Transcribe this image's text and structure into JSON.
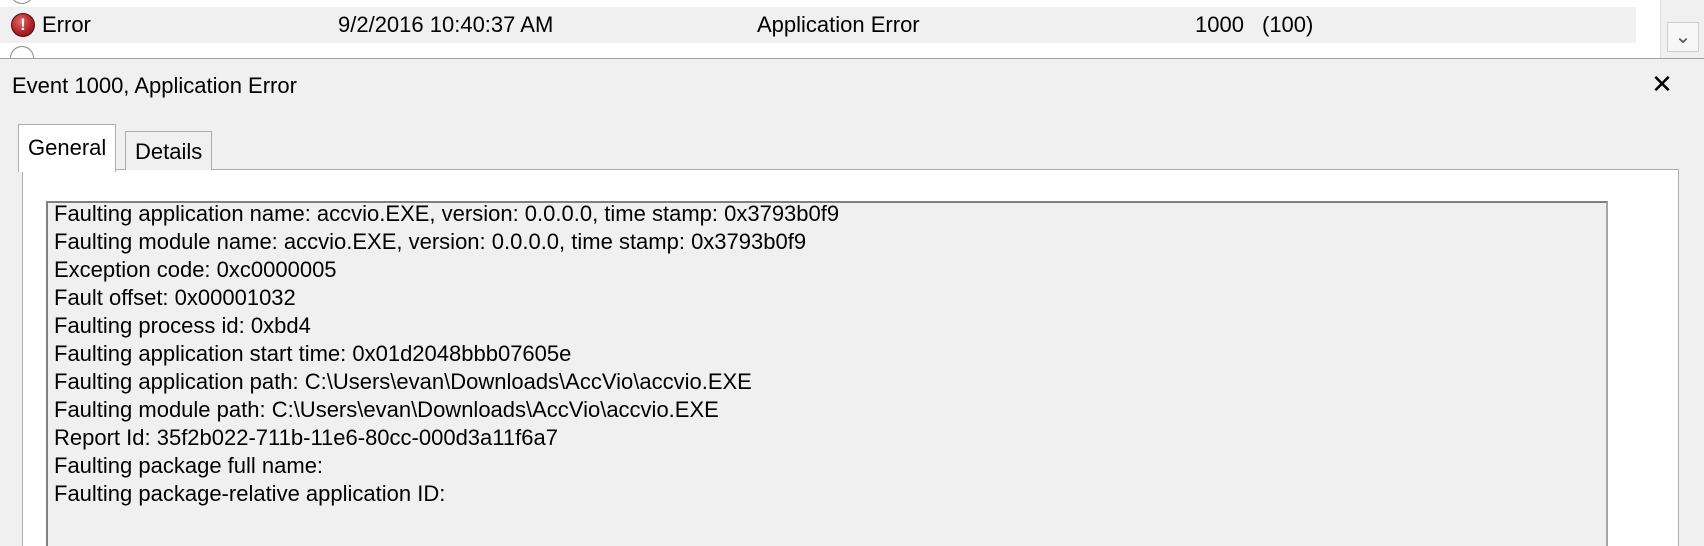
{
  "event_list": {
    "row": {
      "level": "Error",
      "date_time": "9/2/2016 10:40:37 AM",
      "source": "Application Error",
      "event_id": "1000",
      "task_category": "(100)",
      "icon": "error-icon"
    },
    "scroll_icon": "chevron-down-icon"
  },
  "details_pane": {
    "title": "Event 1000, Application Error",
    "close_glyph": "✕",
    "tabs": [
      {
        "label": "General",
        "active": true
      },
      {
        "label": "Details",
        "active": false
      }
    ],
    "description_lines": [
      "Faulting application name: accvio.EXE, version: 0.0.0.0, time stamp: 0x3793b0f9",
      "Faulting module name: accvio.EXE, version: 0.0.0.0, time stamp: 0x3793b0f9",
      "Exception code: 0xc0000005",
      "Fault offset: 0x00001032",
      "Faulting process id: 0xbd4",
      "Faulting application start time: 0x01d2048bbb07605e",
      "Faulting application path: C:\\Users\\evan\\Downloads\\AccVio\\accvio.EXE",
      "Faulting module path: C:\\Users\\evan\\Downloads\\AccVio\\accvio.EXE",
      "Report Id: 35f2b022-711b-11e6-80cc-000d3a11f6a7",
      "Faulting package full name:",
      "Faulting package-relative application ID:"
    ]
  },
  "colors": {
    "error_red": "#b0232b",
    "window_bg": "#f0f0f0",
    "border": "#adadad"
  }
}
